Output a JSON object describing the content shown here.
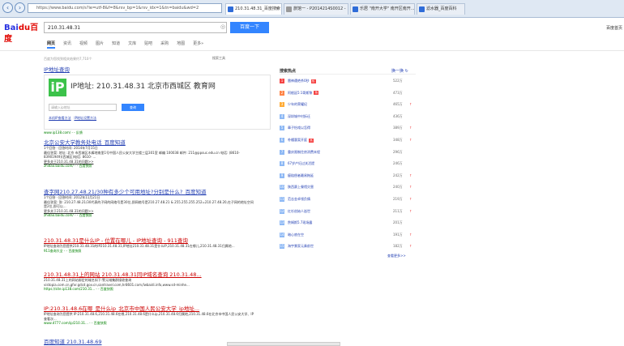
{
  "browser": {
    "address": "https://www.baidu.com/s?ie=utf-8&f=8&rsv_bp=1&rsv_idx=1&tn=baidu&wd=2",
    "tabs": [
      {
        "label": "210.31.48.31_百度搜索",
        "active": true
      },
      {
        "label": "旅馆一 - P2014214S0012 -",
        "active": false
      },
      {
        "label": "乐居 \"南开大学\" 南开区南开...",
        "active": false
      },
      {
        "label": "滤水器_百度百科",
        "active": false
      }
    ]
  },
  "search": {
    "logo_bai": "Bai",
    "logo_du": "du",
    "logo_cn": "百度",
    "query": "210.31.48.31",
    "button": "百度一下",
    "top_right": "百度首页",
    "tabs": [
      "网页",
      "资讯",
      "视频",
      "图片",
      "知道",
      "文库",
      "贴吧",
      "采购",
      "地图",
      "更多»"
    ],
    "result_count": "百度为您找到相关结果约7,710个",
    "tools": "搜索工具"
  },
  "ipcard": {
    "heading": "IP地址查询",
    "logo": "iP",
    "ip_label": "IP地址: 210.31.48.31  北京市西城区 教育网",
    "input_placeholder": "请输入ip地址",
    "query_button": "查询",
    "link1": "本机IP查看方法",
    "link2": "IP地址设置方法",
    "url": "www.ip138.com/ - - 反馈"
  },
  "results": [
    {
      "title": "北京公安大学教务处电话_百度知道",
      "meta": "1个回答 · 回答时间: 2014年7月15日",
      "text": "最佳答案: 地址: 北京 市西城区木樨地南里1号中国人民公安大学主楼三层301室 邮编 100038 邮件: 211@ppsuc.edu.cn 电话: (8610-83901949)(西城区)电话: 8610- ...",
      "more": "更多关于210.31.48.31的问题>>",
      "url": "zhidao.baidu.com/ - - 百度快照"
    },
    {
      "title": "查字网210.27.48.21/30种有多少个可用地址?分别是什么?_百度知道",
      "meta": "1个回答 · 回答时间: 2012年11月21日",
      "text": "最佳答案: 答: 210.27.48.21/30代表的子网的网络号是30位,即网络号是210.27.48.21 & 255.255.255.252=210.27.48.20,在子网的地址空间是2位,即可以...",
      "more": "更多关于210.31.48.31的问题>>",
      "url": "zhidao.baidu.com/ - - 百度快照"
    },
    {
      "title": "210.31.48.31是什么IP - 位置在哪儿 - IP地址查询 - 911查询",
      "text": "IP地址查询为您提供210.31.48.31的IP210.31.48.31,IP地址210.31.48.31是什么IP,210.31.48.31在哪儿,210.31.48.31归属地...",
      "url": "911查询大全 - - 百度快照"
    },
    {
      "title": "210.31.48.31上的网站 210.31.48.31同IP域名查询 210.31.48...",
      "text": "210.31.48.31上的网站绑定的域名如下:警元域集群接收查询 vistopia.com.cn,gfxr.gdcd.gov.cn,santravel.com,hr8601.com,fwbaidi.info,www.sd-minhe...",
      "url": "https://site.ip138.com/210.31... - - 百度快照"
    },
    {
      "title": "IP:210.31.48.6在哪_是什么ip_北京市中国人民公安大学_ip地址...",
      "text": "IP地址查询为您提供 IP:210.31.48.6,210.31.48.6在哪,210.31.48.6是什么ip,210.31.48.6归属地,210.31.48.6在北京市中国人民公安大学、IP查看次...",
      "url": "www.d777.com/ip/210.31... - - 百度快照"
    }
  ],
  "last_title": "百度知道 210.31.48.69",
  "hotlist": {
    "title": "搜索热点",
    "refresh": "换一换",
    "more": "查看更多>>",
    "items": [
      {
        "rank": "1",
        "text": "雷神遭绝杀0秒",
        "badge": "热",
        "count": "522万",
        "up": ""
      },
      {
        "rank": "2",
        "text": "阿根廷5:1哥斯黎",
        "badge": "热",
        "count": "473万",
        "up": ""
      },
      {
        "rank": "3",
        "text": "少年的荣耀纪",
        "badge": "",
        "count": "465万",
        "up": "↑"
      },
      {
        "rank": "4",
        "text": "深圳城中村拆迁",
        "badge": "",
        "count": "436万",
        "up": ""
      },
      {
        "rank": "5",
        "text": "章子怡戏以怎得",
        "badge": "",
        "count": "389万",
        "up": "↑"
      },
      {
        "rank": "6",
        "text": "朴槿惠案开庭",
        "badge": "热",
        "count": "348万",
        "up": "↑"
      },
      {
        "rank": "7",
        "text": "重庆限制住房消费末程",
        "badge": "",
        "count": "296万",
        "up": ""
      },
      {
        "rank": "8",
        "text": "67岁产妇过关活提",
        "badge": "",
        "count": "246万",
        "up": ""
      },
      {
        "rank": "9",
        "text": "瘦赔偿者最易拖延",
        "badge": "",
        "count": "242万",
        "up": "↑"
      },
      {
        "rank": "10",
        "text": "陕西赛上餐馆灾害",
        "badge": "",
        "count": "240万",
        "up": "↑"
      },
      {
        "rank": "11",
        "text": "范志金卓领负情",
        "badge": "",
        "count": "219万",
        "up": "↑"
      },
      {
        "rank": "12",
        "text": "红杉创始人逝世",
        "badge": "",
        "count": "211万",
        "up": "↑"
      },
      {
        "rank": "13",
        "text": "詹姆斯5.7现场露",
        "badge": "",
        "count": "201万",
        "up": ""
      },
      {
        "rank": "14",
        "text": "暗心底在空",
        "badge": "",
        "count": "191万",
        "up": "↑"
      },
      {
        "rank": "15",
        "text": "海宇景家元奏前世",
        "badge": "",
        "count": "182万",
        "up": "↑"
      }
    ]
  }
}
